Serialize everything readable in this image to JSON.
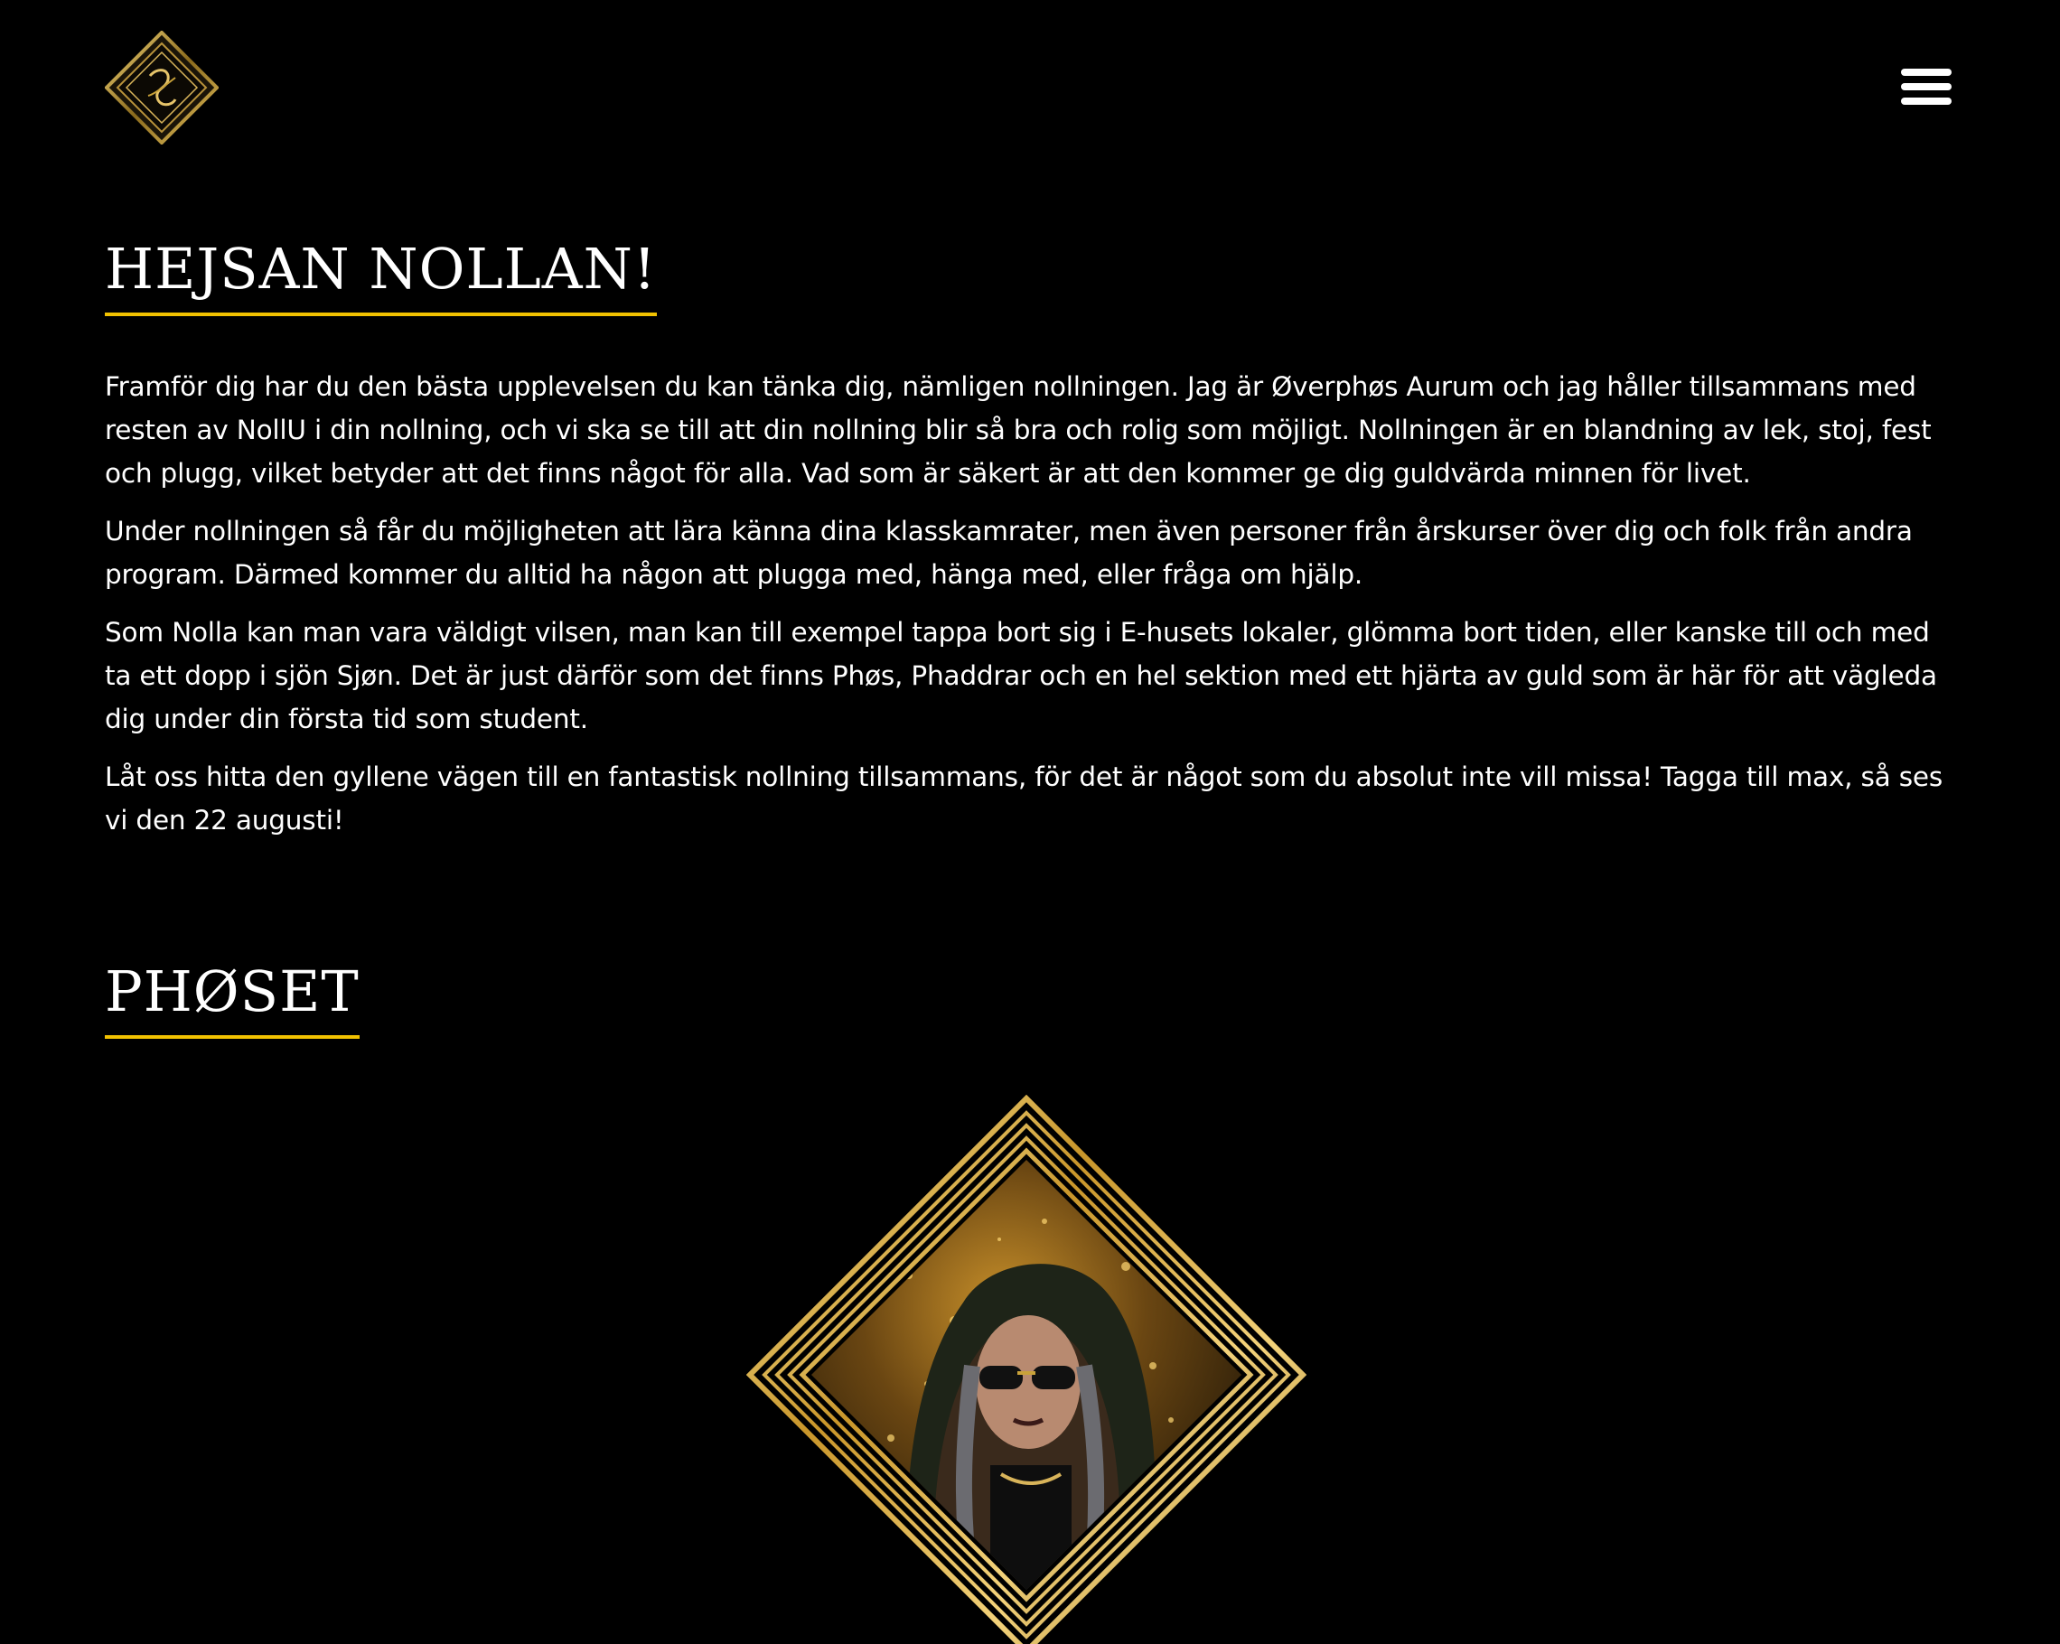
{
  "header": {
    "logo_icon": "ornate-gold-diamond-logo-icon",
    "menu_icon": "hamburger-menu-icon"
  },
  "intro": {
    "title": "HEJSAN NOLLAN!",
    "paragraphs": [
      "Framför dig har du den bästa upplevelsen du kan tänka dig, nämligen nollningen. Jag är Øverphøs Aurum och jag håller tillsammans med resten av NollU i din nollning, och vi ska se till att din nollning blir så bra och rolig som möjligt. Nollningen är en blandning av lek, stoj, fest och plugg, vilket betyder att det finns något för alla. Vad som är säkert är att den kommer ge dig guldvärda minnen för livet.",
      "Under nollningen så får du möjligheten att lära känna dina klasskamrater, men även personer från årskurser över dig och folk från andra program. Därmed kommer du alltid ha någon att plugga med, hänga med, eller fråga om hjälp.",
      "Som Nolla kan man vara väldigt vilsen, man kan till exempel tappa bort sig i E-husets lokaler, glömma bort tiden, eller kanske till och med ta ett dopp i sjön Sjøn. Det är just därför som det finns Phøs, Phaddrar och en hel sektion med ett hjärta av guld som är här för att vägleda dig under din första tid som student.",
      "Låt oss hitta den gyllene vägen till en fantastisk nollning tillsammans, för det är något som du absolut inte vill missa! Tagga till max, så ses vi den 22 augusti!"
    ]
  },
  "phoset": {
    "title": "PHØSET",
    "portrait_icon": "gold-diamond-framed-portrait"
  },
  "colors": {
    "background": "#000000",
    "text": "#ffffff",
    "accent": "#f2c200",
    "gold": "#c9a23a"
  }
}
